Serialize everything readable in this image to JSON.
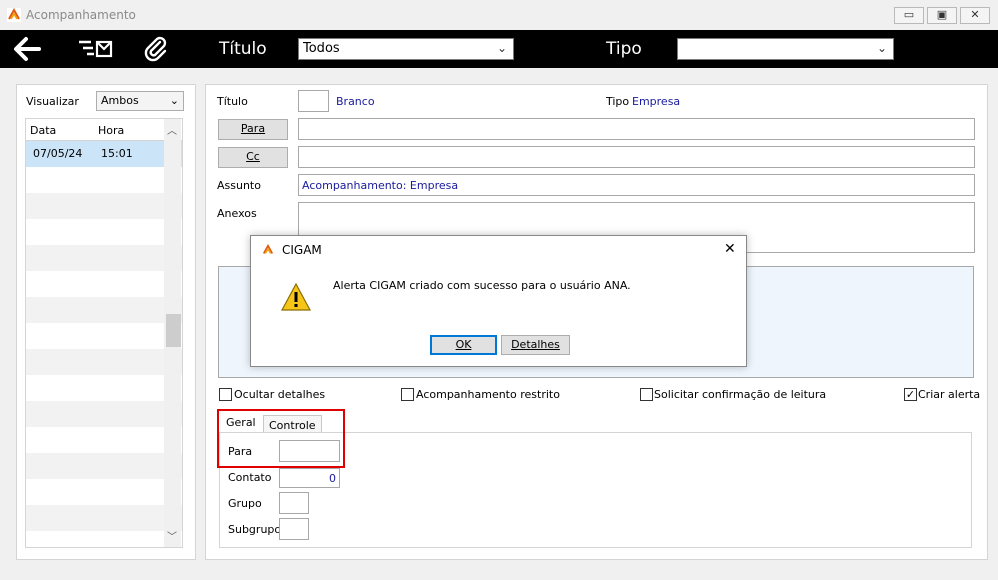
{
  "window": {
    "title": "Acompanhamento",
    "minimize": "▭",
    "maximize": "▣",
    "close": "✕"
  },
  "toolbar": {
    "back_icon": "arrow-left-icon",
    "send_icon": "list-mail-icon",
    "attach_icon": "paperclip-icon",
    "titulo_label": "Título",
    "titulo_value": "Todos",
    "tipo_label": "Tipo",
    "tipo_value": ""
  },
  "left": {
    "visualizar_label": "Visualizar",
    "visualizar_value": "Ambos",
    "columns": [
      "Data",
      "Hora"
    ],
    "rows": [
      {
        "data": "07/05/24",
        "hora": "15:01"
      }
    ]
  },
  "form": {
    "titulo_label": "Título",
    "titulo_value": "Branco",
    "tipo_label": "Tipo",
    "tipo_value": "Empresa",
    "para_button": "Para",
    "cc_button": "Cc",
    "assunto_label": "Assunto",
    "assunto_value": "Acompanhamento: Empresa",
    "anexos_label": "Anexos"
  },
  "checks": {
    "ocultar": {
      "label": "Ocultar detalhes",
      "checked": false
    },
    "restrito": {
      "label": "Acompanhamento restrito",
      "checked": false
    },
    "confirmacao": {
      "label": "Solicitar confirmação de leitura",
      "checked": false
    },
    "criar_alerta": {
      "label": "Criar alerta",
      "checked": true,
      "mark": "✓"
    }
  },
  "tabs": {
    "geral": "Geral",
    "controle": "Controle",
    "para_label": "Para",
    "contato_label": "Contato",
    "contato_value": "0",
    "grupo_label": "Grupo",
    "subgrupo_label": "Subgrupo"
  },
  "dialog": {
    "title": "CIGAM",
    "close": "✕",
    "message": "Alerta CIGAM criado com sucesso para o usuário ANA.",
    "icon": "warning-icon",
    "ok_button": "OK",
    "details_button": "Detalhes"
  },
  "colors": {
    "toolbar": "#000000",
    "selected_row": "#cce4f7",
    "info_area": "#eef5fd",
    "value_text": "#1a1a9c",
    "highlight_box": "#e00000"
  }
}
